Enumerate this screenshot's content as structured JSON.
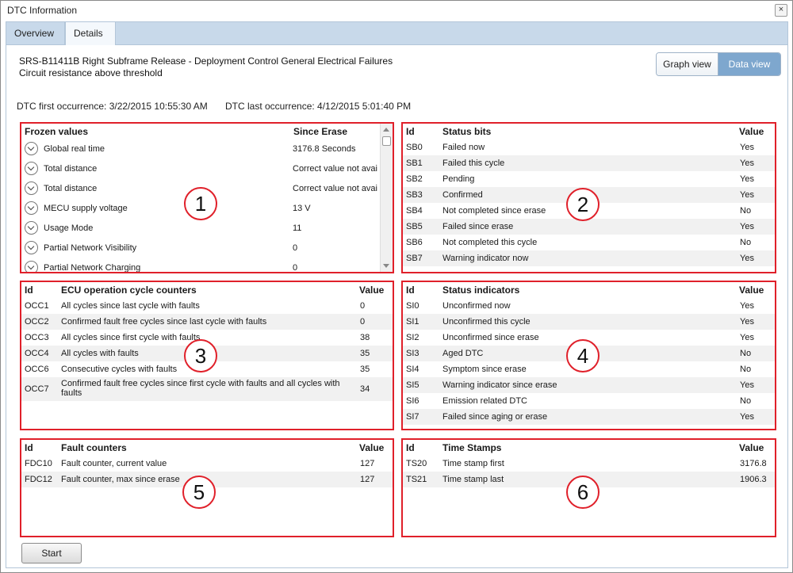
{
  "window": {
    "title": "DTC Information",
    "close_glyph": "×"
  },
  "tabs": [
    {
      "label": "Overview"
    },
    {
      "label": "Details"
    }
  ],
  "details": {
    "line1": "SRS-B11411B Right Subframe Release - Deployment Control General Electrical Failures",
    "line2": "Circuit resistance above threshold",
    "view_graph": "Graph view",
    "view_data": "Data view",
    "first_occurrence": "DTC first occurrence:  3/22/2015 10:55:30 AM",
    "last_occurrence": "DTC last occurrence:  4/12/2015 5:01:40 PM"
  },
  "frozen": {
    "headers": {
      "name": "Frozen values",
      "value": "Since Erase"
    },
    "rows": [
      {
        "name": "Global real time",
        "value": "3176.8 Seconds"
      },
      {
        "name": "Total distance",
        "value": "Correct value not avai"
      },
      {
        "name": "Total distance",
        "value": "Correct value not avai"
      },
      {
        "name": "MECU supply voltage",
        "value": "13 V"
      },
      {
        "name": "Usage Mode",
        "value": "11"
      },
      {
        "name": "Partial Network Visibility",
        "value": "0"
      },
      {
        "name": "Partial Network Charging",
        "value": "0"
      }
    ]
  },
  "status_bits": {
    "headers": {
      "id": "Id",
      "name": "Status bits",
      "value": "Value"
    },
    "rows": [
      {
        "id": "SB0",
        "name": "Failed now",
        "value": "Yes"
      },
      {
        "id": "SB1",
        "name": "Failed this cycle",
        "value": "Yes"
      },
      {
        "id": "SB2",
        "name": "Pending",
        "value": "Yes"
      },
      {
        "id": "SB3",
        "name": "Confirmed",
        "value": "Yes"
      },
      {
        "id": "SB4",
        "name": "Not completed since erase",
        "value": "No"
      },
      {
        "id": "SB5",
        "name": "Failed since erase",
        "value": "Yes"
      },
      {
        "id": "SB6",
        "name": "Not completed this cycle",
        "value": "No"
      },
      {
        "id": "SB7",
        "name": "Warning indicator now",
        "value": "Yes"
      }
    ]
  },
  "ecu_counters": {
    "headers": {
      "id": "Id",
      "name": "ECU operation cycle counters",
      "value": "Value"
    },
    "rows": [
      {
        "id": "OCC1",
        "name": "All cycles since last cycle with faults",
        "value": "0"
      },
      {
        "id": "OCC2",
        "name": "Confirmed fault free cycles since last cycle with faults",
        "value": "0"
      },
      {
        "id": "OCC3",
        "name": "All cycles since first cycle with faults",
        "value": "38"
      },
      {
        "id": "OCC4",
        "name": "All cycles with faults",
        "value": "35"
      },
      {
        "id": "OCC6",
        "name": "Consecutive cycles with faults",
        "value": "35"
      },
      {
        "id": "OCC7",
        "name": "Confirmed fault free cycles since first cycle with faults and all cycles with faults",
        "value": "34"
      }
    ]
  },
  "status_indicators": {
    "headers": {
      "id": "Id",
      "name": "Status indicators",
      "value": "Value"
    },
    "rows": [
      {
        "id": "SI0",
        "name": "Unconfirmed now",
        "value": "Yes"
      },
      {
        "id": "SI1",
        "name": "Unconfirmed this cycle",
        "value": "Yes"
      },
      {
        "id": "SI2",
        "name": "Unconfirmed since erase",
        "value": "Yes"
      },
      {
        "id": "SI3",
        "name": "Aged DTC",
        "value": "No"
      },
      {
        "id": "SI4",
        "name": "Symptom since erase",
        "value": "No"
      },
      {
        "id": "SI5",
        "name": "Warning indicator since erase",
        "value": "Yes"
      },
      {
        "id": "SI6",
        "name": "Emission related DTC",
        "value": "No"
      },
      {
        "id": "SI7",
        "name": "Failed since aging or erase",
        "value": "Yes"
      }
    ]
  },
  "fault_counters": {
    "headers": {
      "id": "Id",
      "name": "Fault counters",
      "value": "Value"
    },
    "rows": [
      {
        "id": "FDC10",
        "name": "Fault counter, current value",
        "value": "127"
      },
      {
        "id": "FDC12",
        "name": "Fault counter, max since erase",
        "value": "127"
      }
    ]
  },
  "time_stamps": {
    "headers": {
      "id": "Id",
      "name": "Time Stamps",
      "value": "Value"
    },
    "rows": [
      {
        "id": "TS20",
        "name": "Time stamp first",
        "value": "3176.8"
      },
      {
        "id": "TS21",
        "name": "Time stamp last",
        "value": "1906.3"
      }
    ]
  },
  "badges": [
    "1",
    "2",
    "3",
    "4",
    "5",
    "6"
  ],
  "start_label": "Start",
  "colors": {
    "annotation_red": "#e0202a",
    "tab_bar": "#c8d9ea",
    "active_view": "#7ea7ce"
  }
}
